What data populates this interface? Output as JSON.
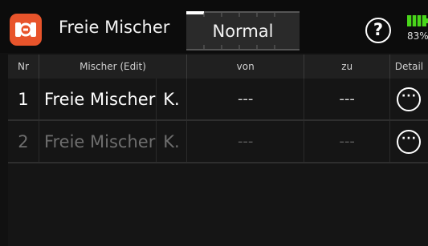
{
  "header": {
    "app_icon": "mixer-icon",
    "title": "Freie Mischer",
    "mode": "Normal",
    "help_icon": "?",
    "battery_percent": "83%",
    "battery_color": "#49d61a",
    "app_icon_color": "#e8542b"
  },
  "table": {
    "columns": [
      "Nr",
      "Mischer (Edit)",
      "von",
      "zu",
      "Detail"
    ],
    "rows": [
      {
        "nr": "1",
        "name": "Freie Mischer",
        "type": "K.",
        "von": "---",
        "zu": "---",
        "detail": "···",
        "active": true
      },
      {
        "nr": "2",
        "name": "Freie Mischer",
        "type": "K.",
        "von": "---",
        "zu": "---",
        "detail": "···",
        "active": false
      }
    ]
  }
}
